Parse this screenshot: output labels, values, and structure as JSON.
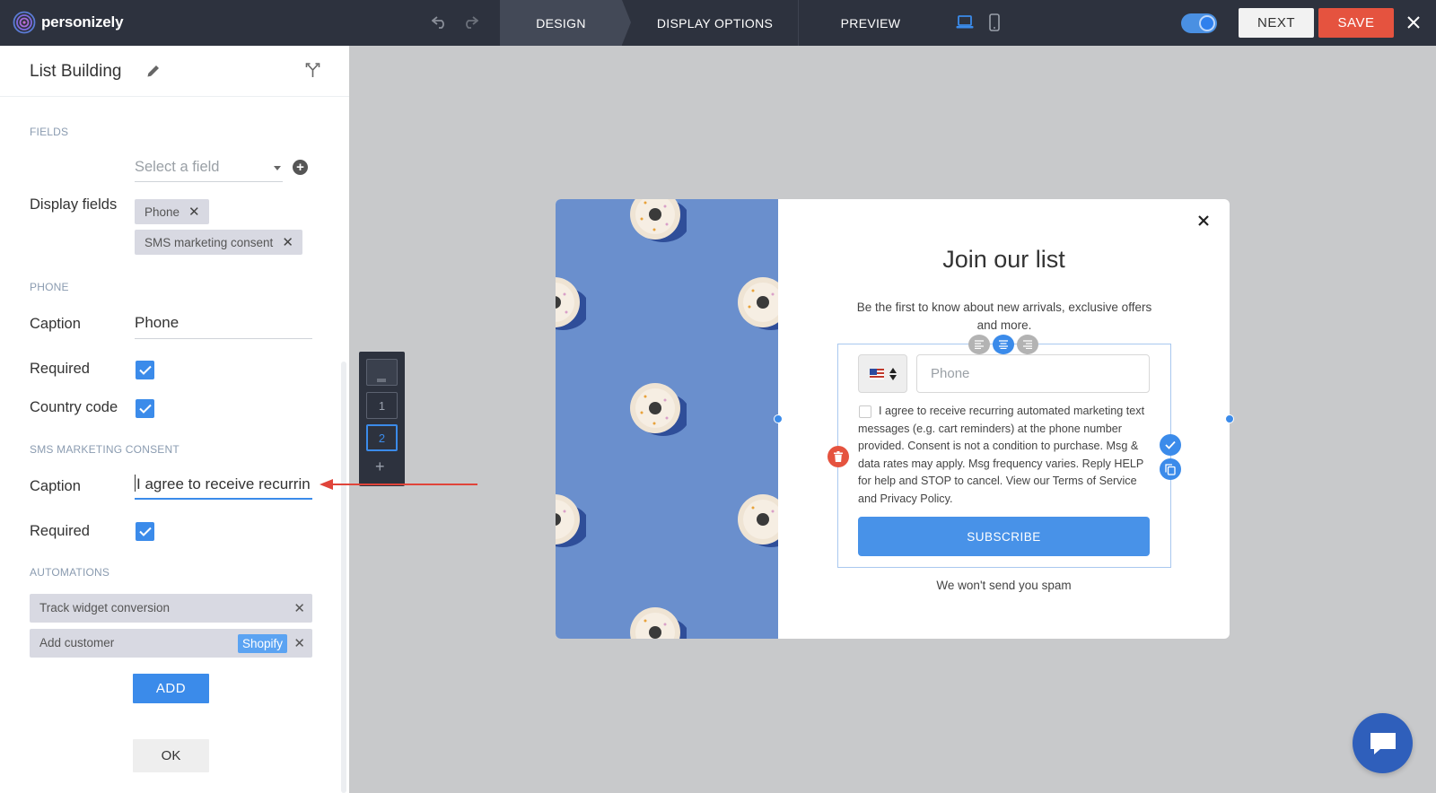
{
  "app": {
    "logo_text": "personizely"
  },
  "topbar": {
    "tabs": [
      {
        "label": "DESIGN",
        "active": true
      },
      {
        "label": "DISPLAY OPTIONS",
        "active": false
      },
      {
        "label": "PREVIEW",
        "active": false
      }
    ],
    "toggle_on": true,
    "next_label": "NEXT",
    "save_label": "SAVE"
  },
  "sidebar": {
    "title": "List Building",
    "fields_section": "FIELDS",
    "select_placeholder": "Select a field",
    "display_fields_label": "Display fields",
    "display_fields": [
      "Phone",
      "SMS marketing consent"
    ],
    "phone_section": "PHONE",
    "phone": {
      "caption_label": "Caption",
      "caption_value": "Phone",
      "required_label": "Required",
      "required_checked": true,
      "country_code_label": "Country code",
      "country_code_checked": true
    },
    "sms_section": "SMS MARKETING CONSENT",
    "sms": {
      "caption_label": "Caption",
      "caption_value": "I agree to receive recurrin",
      "required_label": "Required",
      "required_checked": true
    },
    "automations_section": "AUTOMATIONS",
    "automations": [
      {
        "label": "Track widget conversion",
        "badge": ""
      },
      {
        "label": "Add customer",
        "badge": "Shopify"
      }
    ],
    "add_label": "ADD",
    "ok_label": "OK"
  },
  "steps": {
    "items": [
      "1",
      "2"
    ],
    "active": "2",
    "add_symbol": "+"
  },
  "popup": {
    "title": "Join our list",
    "subtitle": "Be the first to know about new arrivals, exclusive offers and more.",
    "phone_placeholder": "Phone",
    "consent_text": "I agree to receive recurring automated marketing text messages (e.g. cart reminders) at the phone number provided. Consent is not a condition to purchase. Msg & data rates may apply. Msg frequency varies. Reply HELP for help and STOP to cancel. View our Terms of Service and Privacy Policy.",
    "subscribe_label": "SUBSCRIBE",
    "footer_text": "We won't send you spam"
  },
  "colors": {
    "topbar_bg": "#2d323e",
    "accent": "#3b8bea",
    "save": "#e5533f",
    "canvas_bg": "#c8c9cb",
    "popup_image_bg": "#6a8fcd"
  },
  "icons": {
    "logo": "personizely-logo-icon",
    "undo": "undo-icon",
    "redo": "redo-icon",
    "desktop": "desktop-icon",
    "mobile": "mobile-icon",
    "close": "close-icon",
    "edit": "pencil-icon",
    "branch": "branch-icon",
    "chat": "chat-icon"
  }
}
